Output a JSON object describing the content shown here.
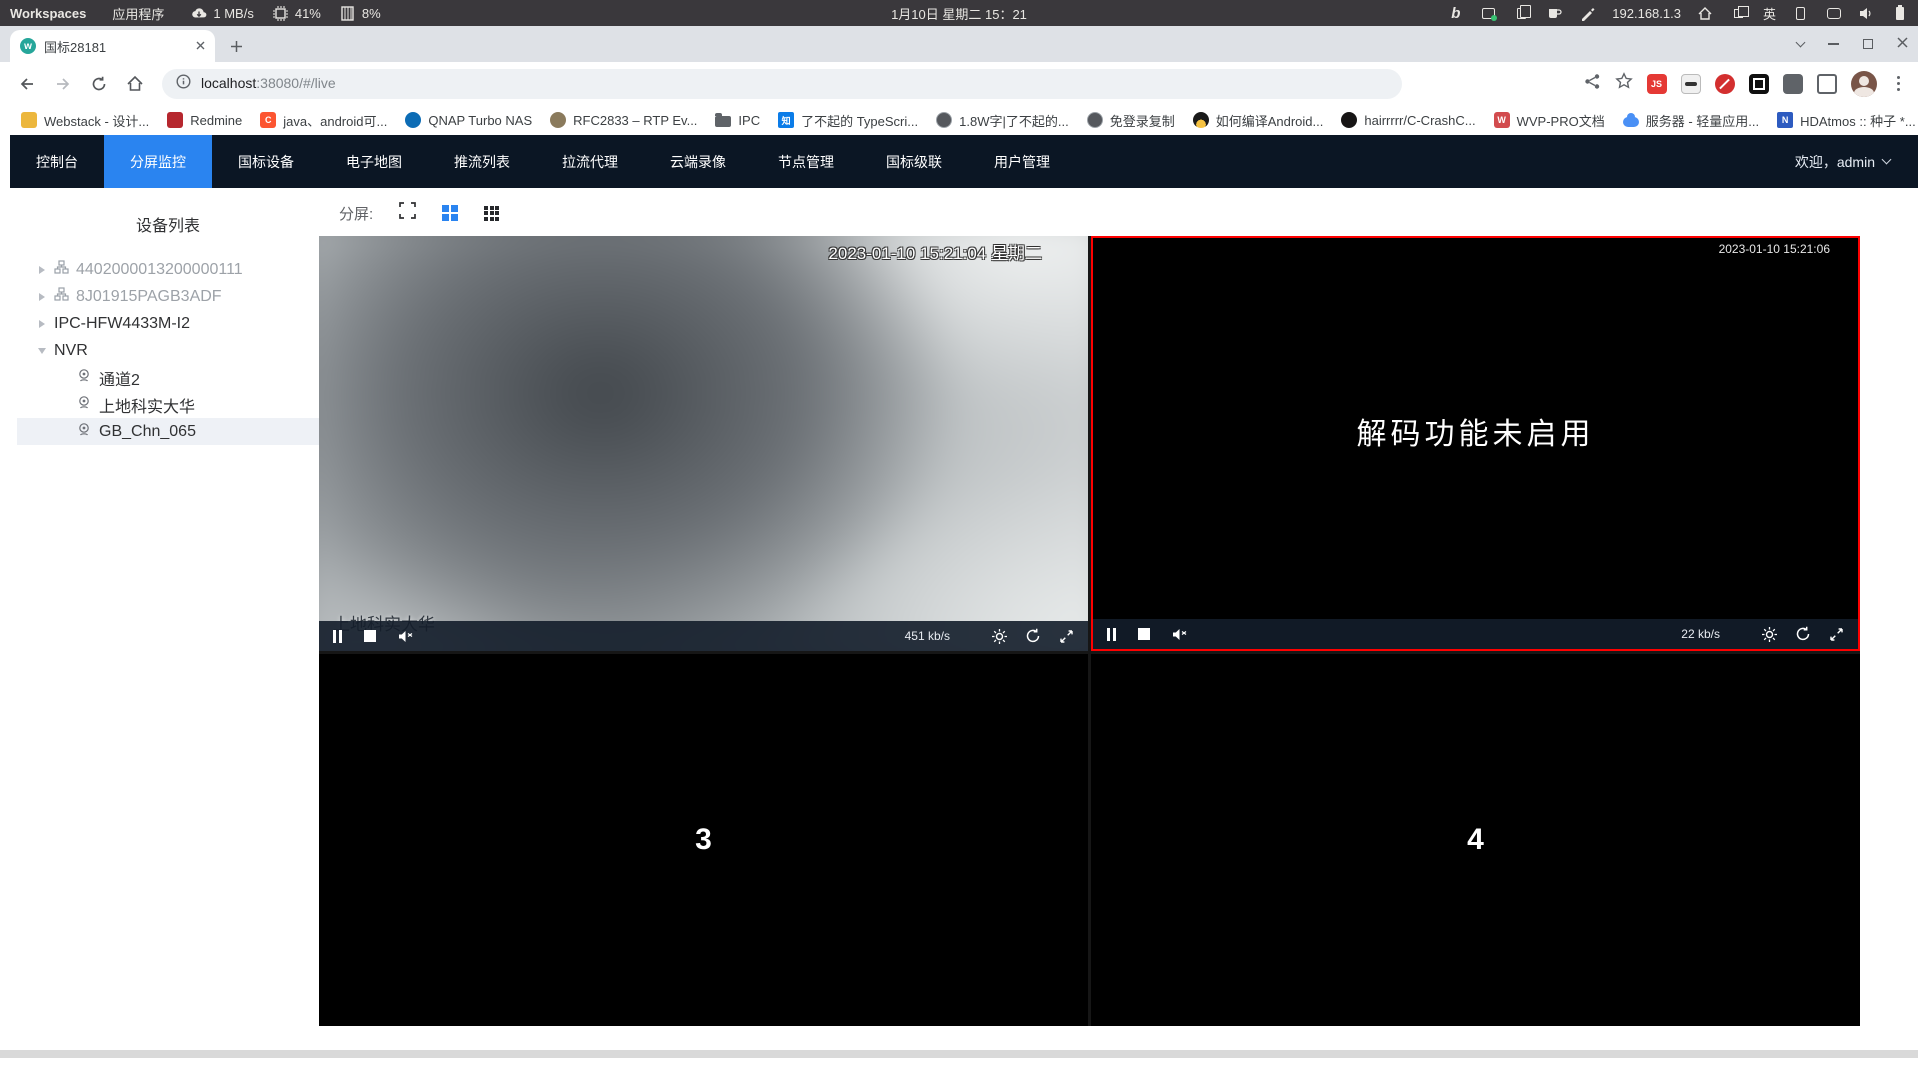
{
  "system_bar": {
    "workspaces_label": "Workspaces",
    "applications_label": "应用程序",
    "net_speed": "1 MB/s",
    "cpu_percent": "41%",
    "mem_percent": "8%",
    "datetime": "1月10日 星期二 15：21",
    "bing_glyph": "b",
    "ip_address": "192.168.1.3",
    "input_method": "英"
  },
  "browser": {
    "tab_title": "国标28181",
    "tab_favicon_letter": "w",
    "url": {
      "host": "localhost",
      "rest": ":38080/#/live"
    },
    "extension_js_label": "JS",
    "bookmarks": [
      {
        "label": "Webstack - 设计..."
      },
      {
        "label": "Redmine"
      },
      {
        "label": "java、android可...",
        "letter": "C"
      },
      {
        "label": "QNAP Turbo NAS"
      },
      {
        "label": "RFC2833 – RTP Ev..."
      },
      {
        "label": "IPC"
      },
      {
        "label": "了不起的 TypeScri...",
        "letter": "知"
      },
      {
        "label": "1.8W字|了不起的..."
      },
      {
        "label": "免登录复制"
      },
      {
        "label": "如何编译Android..."
      },
      {
        "label": "hairrrrr/C-CrashC..."
      },
      {
        "label": "WVP-PRO文档",
        "letter": "W"
      },
      {
        "label": "服务器 - 轻量应用..."
      },
      {
        "label": "HDAtmos :: 种子 *...",
        "letter": "N"
      }
    ],
    "bookmarks_overflow": "»"
  },
  "nav": {
    "items": [
      "控制台",
      "分屏监控",
      "国标设备",
      "电子地图",
      "推流列表",
      "拉流代理",
      "云端录像",
      "节点管理",
      "国标级联",
      "用户管理"
    ],
    "active_item": "分屏监控",
    "welcome": "欢迎，admin"
  },
  "sidebar": {
    "title": "设备列表",
    "tree": [
      {
        "label": "4402000013200000111"
      },
      {
        "label": "8J01915PAGB3ADF"
      },
      {
        "label": "IPC-HFW4433M-I2"
      },
      {
        "label": "NVR"
      },
      {
        "label": "通道2"
      },
      {
        "label": "上地科实大华"
      },
      {
        "label": "GB_Chn_065"
      }
    ],
    "selected_item": "GB_Chn_065"
  },
  "main": {
    "split_label": "分屏:",
    "tiles": {
      "tile1": {
        "timestamp": "2023-01-10 15:21:04 星期二",
        "camera_label": "上地科实大华",
        "bitrate": "451 kb/s"
      },
      "tile2": {
        "timestamp": "2023-01-10 15:21:06",
        "message": "解码功能未启用",
        "bitrate": "22 kb/s"
      },
      "tile3": {
        "number": "3"
      },
      "tile4": {
        "number": "4"
      }
    }
  },
  "colors": {
    "accent_blue": "#2a84f0",
    "nav_bg": "#0b1624",
    "selected_tile_border": "#fe0000",
    "favicon_teal": "#26a69a"
  }
}
